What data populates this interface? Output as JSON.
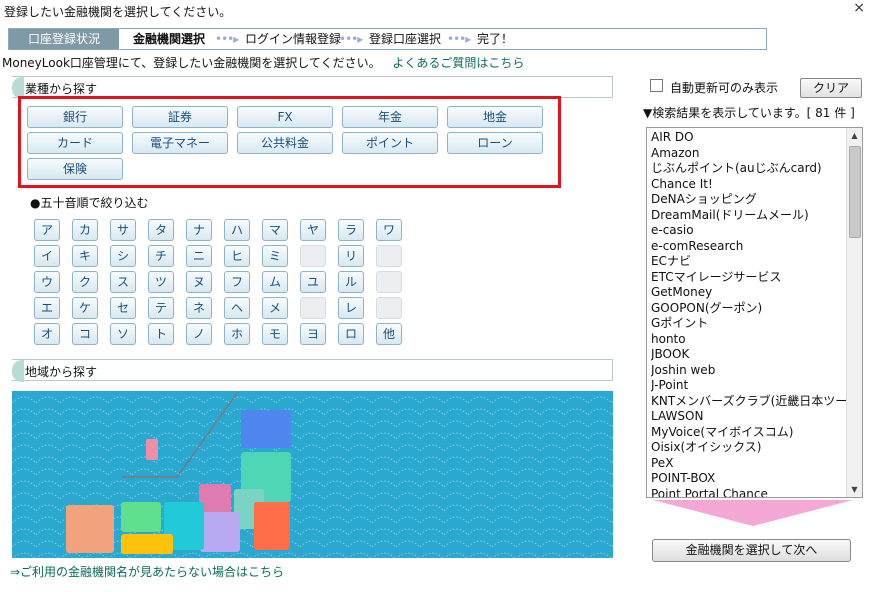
{
  "window": {
    "title": "登録したい金融機関を選択してください。",
    "close_glyph": "×"
  },
  "steps": {
    "status_label": "口座登録状況",
    "items": [
      "金融機関選択",
      "ログイン情報登録",
      "登録口座選択",
      "完了！"
    ]
  },
  "intro": {
    "text": "MoneyLook口座管理にて、登録したい金融機関を選択してください。",
    "faq_link": "よくあるご質問はこちら"
  },
  "industry": {
    "header": "業種から探す",
    "buttons": [
      "銀行",
      "証券",
      "FX",
      "年金",
      "地金",
      "カード",
      "電子マネー",
      "公共料金",
      "ポイント",
      "ローン",
      "保険"
    ]
  },
  "gojuon": {
    "label": "●五十音順で絞り込む",
    "columns": [
      [
        "ア",
        "イ",
        "ウ",
        "エ",
        "オ"
      ],
      [
        "カ",
        "キ",
        "ク",
        "ケ",
        "コ"
      ],
      [
        "サ",
        "シ",
        "ス",
        "セ",
        "ソ"
      ],
      [
        "タ",
        "チ",
        "ツ",
        "テ",
        "ト"
      ],
      [
        "ナ",
        "ニ",
        "ヌ",
        "ネ",
        "ノ"
      ],
      [
        "ハ",
        "ヒ",
        "フ",
        "ヘ",
        "ホ"
      ],
      [
        "マ",
        "ミ",
        "ム",
        "メ",
        "モ"
      ],
      [
        "ヤ",
        "",
        "ユ",
        "",
        "ヨ"
      ],
      [
        "ラ",
        "リ",
        "ル",
        "レ",
        "ロ"
      ],
      [
        "ワ",
        "",
        "",
        "",
        "他"
      ]
    ]
  },
  "region": {
    "header": "地域から探す"
  },
  "not_found_link": "⇒ご利用の金融機関名が見あたらない場合はこちら",
  "filter": {
    "auto_update_label": "自動更新可のみ表示",
    "clear_button": "クリア"
  },
  "results": {
    "status": "▼検索結果を表示しています。[ 81 件 ]",
    "items": [
      "AIR DO",
      "Amazon",
      "じぶんポイント(auじぶんcard)",
      "Chance It!",
      "DeNAショッピング",
      "DreamMail(ドリームメール)",
      "e-casio",
      "e-comResearch",
      "ECナビ",
      "ETCマイレージサービス",
      "GetMoney",
      "GOOPON(グーポン)",
      "Gポイント",
      "honto",
      "JBOOK",
      "Joshin web",
      "J-Point",
      "KNTメンバーズクラブ(近畿日本ツー",
      "LAWSON",
      "MyVoice(マイボイスコム)",
      "Oisix(オイシックス)",
      "PeX",
      "POINT-BOX",
      "Point Portal Chance"
    ]
  },
  "next_button": "金融機関を選択して次へ",
  "colors": {
    "highlight": "#e0141e",
    "map_sea": "#2aa8cf",
    "link": "#0a6a5a"
  }
}
